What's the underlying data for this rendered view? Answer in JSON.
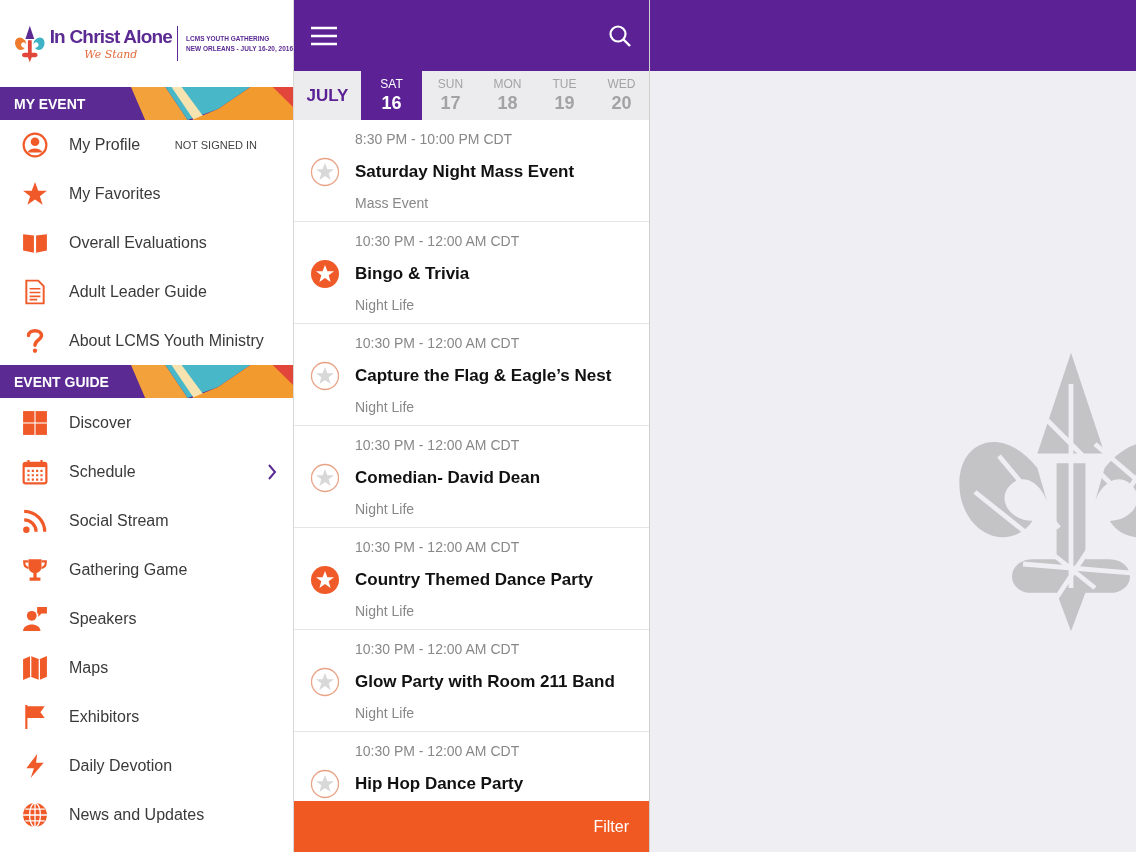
{
  "logo": {
    "title": "In Christ Alone",
    "tagline": "We Stand",
    "event_lines": [
      "LCMS YOUTH GATHERING",
      "NEW ORLEANS - JULY 16-20, 2016"
    ]
  },
  "sidebar": {
    "sections": [
      {
        "title": "MY EVENT",
        "items": [
          {
            "label": "My Profile",
            "status": "NOT SIGNED IN",
            "has_submenu": false
          },
          {
            "label": "My Favorites",
            "has_submenu": false
          },
          {
            "label": "Overall Evaluations",
            "has_submenu": false
          },
          {
            "label": "Adult Leader Guide",
            "has_submenu": false
          },
          {
            "label": "About LCMS Youth Ministry",
            "has_submenu": false
          }
        ]
      },
      {
        "title": "EVENT GUIDE",
        "items": [
          {
            "label": "Discover",
            "has_submenu": false
          },
          {
            "label": "Schedule",
            "has_submenu": true
          },
          {
            "label": "Social Stream",
            "has_submenu": false
          },
          {
            "label": "Gathering Game",
            "has_submenu": false
          },
          {
            "label": "Speakers",
            "has_submenu": false
          },
          {
            "label": "Maps",
            "has_submenu": false
          },
          {
            "label": "Exhibitors",
            "has_submenu": false
          },
          {
            "label": "Daily Devotion",
            "has_submenu": false
          },
          {
            "label": "News and Updates",
            "has_submenu": false
          }
        ]
      }
    ]
  },
  "schedule": {
    "month": "JULY",
    "days": [
      {
        "weekday": "SAT",
        "day": "16",
        "selected": true
      },
      {
        "weekday": "SUN",
        "day": "17",
        "selected": false
      },
      {
        "weekday": "MON",
        "day": "18",
        "selected": false
      },
      {
        "weekday": "TUE",
        "day": "19",
        "selected": false
      },
      {
        "weekday": "WED",
        "day": "20",
        "selected": false
      }
    ],
    "events": [
      {
        "time": "8:30 PM - 10:00 PM CDT",
        "title": "Saturday Night Mass Event",
        "category": "Mass Event",
        "favorite": false
      },
      {
        "time": "10:30 PM - 12:00 AM CDT",
        "title": "Bingo & Trivia",
        "category": "Night Life",
        "favorite": true
      },
      {
        "time": "10:30 PM - 12:00 AM CDT",
        "title": "Capture the Flag & Eagle’s Nest",
        "category": "Night Life",
        "favorite": false
      },
      {
        "time": "10:30 PM - 12:00 AM CDT",
        "title": "Comedian- David Dean",
        "category": "Night Life",
        "favorite": false
      },
      {
        "time": "10:30 PM - 12:00 AM CDT",
        "title": "Country Themed Dance Party",
        "category": "Night Life",
        "favorite": true
      },
      {
        "time": "10:30 PM - 12:00 AM CDT",
        "title": "Glow Party with Room 211 Band",
        "category": "Night Life",
        "favorite": false
      },
      {
        "time": "10:30 PM - 12:00 AM CDT",
        "title": "Hip Hop Dance Party",
        "favorite": false
      }
    ],
    "filter_button": "Filter"
  }
}
